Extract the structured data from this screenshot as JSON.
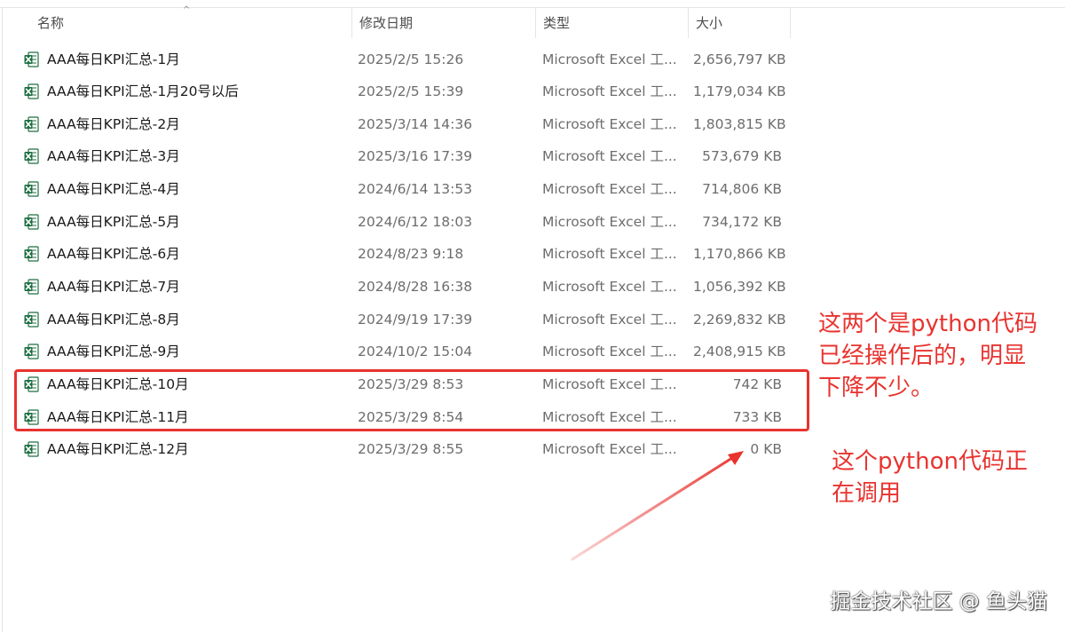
{
  "columns": {
    "name": "名称",
    "date": "修改日期",
    "type": "类型",
    "size": "大小"
  },
  "sort_indicator": "^",
  "files": [
    {
      "name": "AAA每日KPI汇总-1月",
      "date": "2025/2/5 15:26",
      "type": "Microsoft Excel 工...",
      "size": "2,656,797 KB",
      "icon": "excel-file-icon"
    },
    {
      "name": "AAA每日KPI汇总-1月20号以后",
      "date": "2025/2/5 15:39",
      "type": "Microsoft Excel 工...",
      "size": "1,179,034 KB",
      "icon": "excel-file-icon"
    },
    {
      "name": "AAA每日KPI汇总-2月",
      "date": "2025/3/14 14:36",
      "type": "Microsoft Excel 工...",
      "size": "1,803,815 KB",
      "icon": "excel-file-icon"
    },
    {
      "name": "AAA每日KPI汇总-3月",
      "date": "2025/3/16 17:39",
      "type": "Microsoft Excel 工...",
      "size": "573,679 KB",
      "icon": "excel-file-icon"
    },
    {
      "name": "AAA每日KPI汇总-4月",
      "date": "2024/6/14 13:53",
      "type": "Microsoft Excel 工...",
      "size": "714,806 KB",
      "icon": "excel-file-icon"
    },
    {
      "name": "AAA每日KPI汇总-5月",
      "date": "2024/6/12 18:03",
      "type": "Microsoft Excel 工...",
      "size": "734,172 KB",
      "icon": "excel-file-icon"
    },
    {
      "name": "AAA每日KPI汇总-6月",
      "date": "2024/8/23 9:18",
      "type": "Microsoft Excel 工...",
      "size": "1,170,866 KB",
      "icon": "excel-file-icon"
    },
    {
      "name": "AAA每日KPI汇总-7月",
      "date": "2024/8/28 16:38",
      "type": "Microsoft Excel 工...",
      "size": "1,056,392 KB",
      "icon": "excel-file-icon"
    },
    {
      "name": "AAA每日KPI汇总-8月",
      "date": "2024/9/19 17:39",
      "type": "Microsoft Excel 工...",
      "size": "2,269,832 KB",
      "icon": "excel-file-icon"
    },
    {
      "name": "AAA每日KPI汇总-9月",
      "date": "2024/10/2 15:04",
      "type": "Microsoft Excel 工...",
      "size": "2,408,915 KB",
      "icon": "excel-file-icon"
    },
    {
      "name": "AAA每日KPI汇总-10月",
      "date": "2025/3/29 8:53",
      "type": "Microsoft Excel 工...",
      "size": "742 KB",
      "icon": "excel-file-icon"
    },
    {
      "name": "AAA每日KPI汇总-11月",
      "date": "2025/3/29 8:54",
      "type": "Microsoft Excel 工...",
      "size": "733 KB",
      "icon": "excel-file-icon"
    },
    {
      "name": "AAA每日KPI汇总-12月",
      "date": "2025/3/29 8:55",
      "type": "Microsoft Excel 工...",
      "size": "0 KB",
      "icon": "excel-file-icon"
    }
  ],
  "annotations": {
    "note_processed": "这两个是python代码\n已经操作后的，明显\n下降不少。",
    "note_in_progress": "这个python代码正\n在调用",
    "color": "#e8332f"
  },
  "watermark": "掘金技术社区 @ 鱼头猫",
  "excel_icon_color": "#1d6f42"
}
